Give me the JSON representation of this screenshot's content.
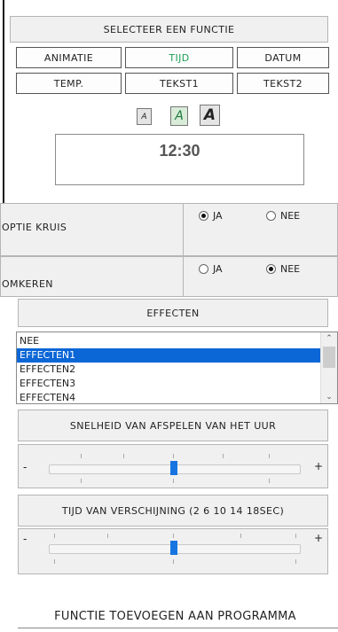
{
  "header": {
    "title": "SELECTEER EEN FUNCTIE"
  },
  "functions": [
    {
      "label": "ANIMATIE",
      "selected": false
    },
    {
      "label": "TIJD",
      "selected": true
    },
    {
      "label": "DATUM",
      "selected": false
    },
    {
      "label": "TEMP.",
      "selected": false
    },
    {
      "label": "TEKST1",
      "selected": false
    },
    {
      "label": "TEKST2",
      "selected": false
    }
  ],
  "font_sizes": [
    "A",
    "A",
    "A"
  ],
  "clock": {
    "value": "12:30"
  },
  "options": {
    "cross": {
      "label": "OPTIE KRUIS",
      "yes": "JA",
      "no": "NEE",
      "selected": "JA"
    },
    "reverse": {
      "label": "OMKEREN",
      "yes": "JA",
      "no": "NEE",
      "selected": "NEE"
    }
  },
  "effects": {
    "title": "EFFECTEN",
    "items": [
      "NEE",
      "EFFECTEN1",
      "EFFECTEN2",
      "EFFECTEN3",
      "EFFECTEN4"
    ],
    "selected_index": 1
  },
  "speed": {
    "title": "SNELHEID VAN AFSPELEN VAN HET UUR",
    "minus": "-",
    "plus": "+",
    "value": 0.5
  },
  "appear": {
    "title": "TIJD VAN VERSCHIJNING (2 6 10 14 18SEC)",
    "minus": "-",
    "plus": "+",
    "value": 0.5
  },
  "footer": {
    "add_label": "FUNCTIE TOEVOEGEN AAN PROGRAMMA"
  },
  "colors": {
    "selected_text": "#1fa05a",
    "list_highlight": "#0b66d6",
    "slider_thumb": "#1675e0"
  }
}
